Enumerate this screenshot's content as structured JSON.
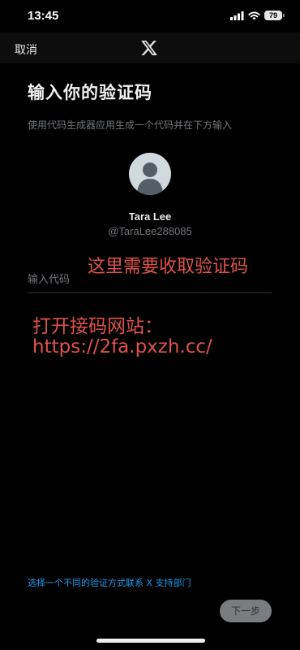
{
  "status_bar": {
    "time": "13:45",
    "battery": "79",
    "icons": [
      "cellular-signal-icon",
      "wifi-icon",
      "battery-icon"
    ]
  },
  "nav": {
    "cancel_label": "取消",
    "logo": "x-logo-icon"
  },
  "page": {
    "title": "输入你的验证码",
    "subtitle": "使用代码生成器应用生成一个代码并在下方输入"
  },
  "user": {
    "name": "Tara Lee",
    "handle": "@TaraLee288085",
    "avatar": "default-avatar-icon"
  },
  "code_input": {
    "placeholder": "输入代码",
    "value": ""
  },
  "overlay": {
    "note": "这里需要收取验证码",
    "site_label": "打开接码网站：",
    "site_url": "https://2fa.pxzh.cc/"
  },
  "footer": {
    "alt_link": "选择一个不同的验证方式联系 X 支持部门",
    "next_label": "下一步"
  },
  "colors": {
    "background": "#000000",
    "accent_blue": "#1d9bf0",
    "overlay_red": "#e0524b",
    "muted_text": "#71767b",
    "next_button_bg": "#7a7d80"
  }
}
